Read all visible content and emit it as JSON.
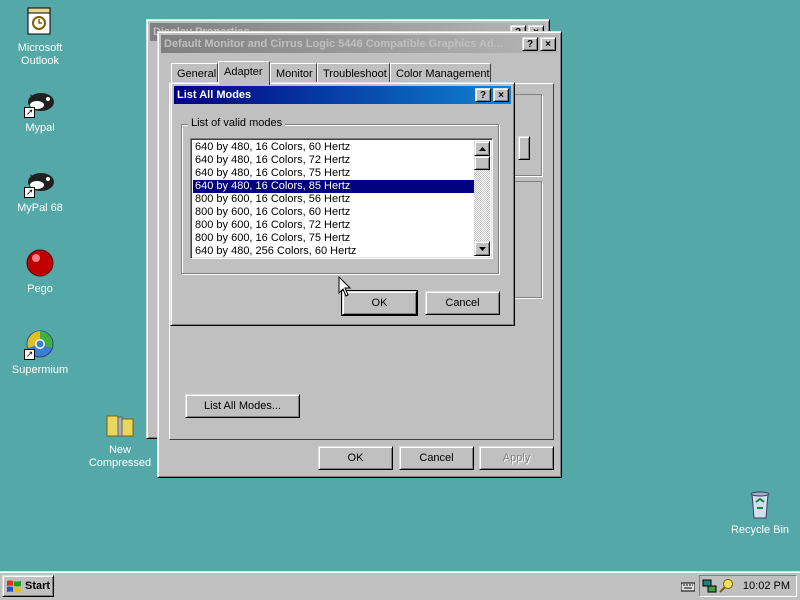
{
  "desktop": {
    "icons": [
      {
        "label1": "Microsoft",
        "label2": "Outlook",
        "icon": "outlook-icon"
      },
      {
        "label1": "Mypal",
        "label2": "",
        "icon": "mypal-icon"
      },
      {
        "label1": "MyPal 68",
        "label2": "",
        "icon": "mypal-68-icon"
      },
      {
        "label1": "Pego",
        "label2": "",
        "icon": "pego-icon"
      },
      {
        "label1": "Supermium",
        "label2": "",
        "icon": "supermium-icon"
      },
      {
        "label1": "New",
        "label2": "Compressed",
        "icon": "zip-folder-icon"
      },
      {
        "label1": "Recycle Bin",
        "label2": "",
        "icon": "recycle-bin-icon"
      }
    ]
  },
  "display_properties": {
    "title": "Display Properties",
    "help": "?",
    "close": "×"
  },
  "adapter_window": {
    "title": "Default Monitor and Cirrus Logic 5446 Compatible Graphics Ad...",
    "help": "?",
    "close": "×",
    "tabs": [
      "General",
      "Adapter",
      "Monitor",
      "Troubleshoot",
      "Color Management"
    ],
    "list_all_modes_label": "List All Modes...",
    "ok_label": "OK",
    "cancel_label": "Cancel",
    "apply_label": "Apply"
  },
  "list_modes_dialog": {
    "title": "List All Modes",
    "help": "?",
    "close": "×",
    "group_label": "List of valid modes",
    "modes": [
      "640 by 480, 16 Colors, 60 Hertz",
      "640 by 480, 16 Colors, 72 Hertz",
      "640 by 480, 16 Colors, 75 Hertz",
      "640 by 480, 16 Colors, 85 Hertz",
      "800 by 600, 16 Colors, 56 Hertz",
      "800 by 600, 16 Colors, 60 Hertz",
      "800 by 600, 16 Colors, 72 Hertz",
      "800 by 600, 16 Colors, 75 Hertz",
      "640 by 480, 256 Colors, 60 Hertz"
    ],
    "selected_mode": "640 by 480, 16 Colors, 85 Hertz",
    "ok_label": "OK",
    "cancel_label": "Cancel"
  },
  "taskbar": {
    "start_label": "Start",
    "clock": "10:02 PM",
    "tray_icons": [
      "keyboard-icon",
      "network-icon",
      "search-tray-icon"
    ]
  },
  "colors": {
    "desktop": "#55a8a8",
    "face": "#c0c0c0",
    "active_title": "#000080",
    "selection": "#000080"
  }
}
